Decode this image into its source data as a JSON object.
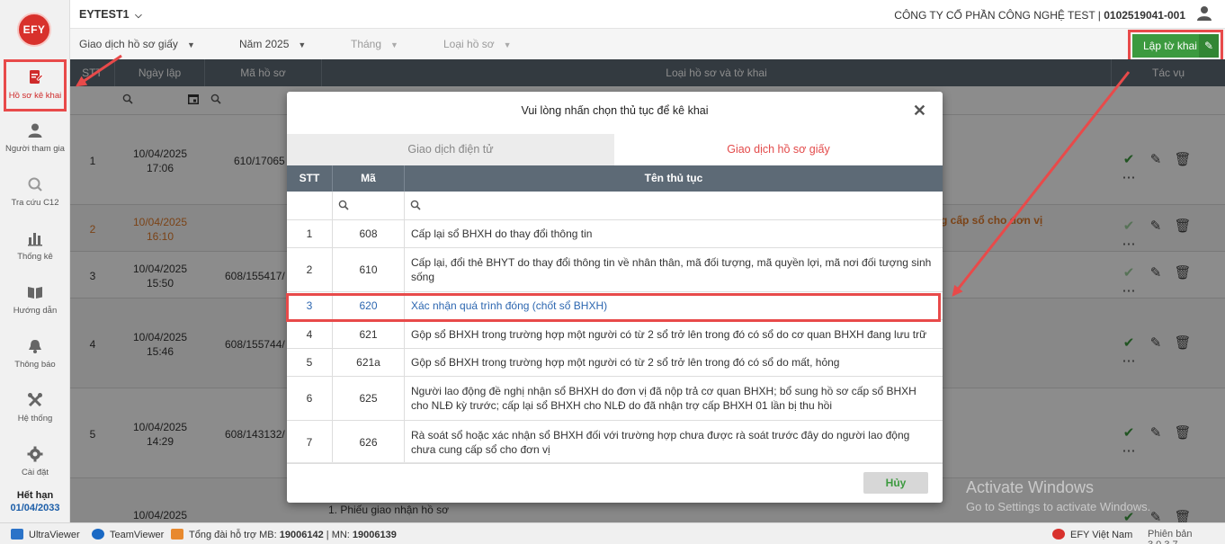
{
  "sidebar": {
    "logo": "EFY",
    "items": [
      {
        "label": "Hồ sơ kê khai",
        "icon": "document-edit-icon"
      },
      {
        "label": "Người tham gia",
        "icon": "user-icon"
      },
      {
        "label": "Tra cứu C12",
        "icon": "search-icon"
      },
      {
        "label": "Thống kê",
        "icon": "bar-chart-icon"
      },
      {
        "label": "Hướng dẫn",
        "icon": "book-icon"
      },
      {
        "label": "Thông báo",
        "icon": "bell-icon"
      },
      {
        "label": "Hệ thống",
        "icon": "tools-icon"
      },
      {
        "label": "Cài đặt",
        "icon": "gear-icon"
      }
    ],
    "expiry_label": "Hết hạn",
    "expiry_date": "01/04/2033"
  },
  "header": {
    "tenant": "EYTEST1",
    "company": "CÔNG TY CỔ PHẦN CÔNG NGHỆ TEST | ",
    "tax_code": "0102519041-001"
  },
  "filters": {
    "type": "Giao dịch hồ sơ giấy",
    "year": "Năm 2025",
    "month": "Tháng",
    "doc_type": "Loại hồ sơ",
    "create_button": "Lập tờ khai"
  },
  "main_table": {
    "headers": [
      "STT",
      "Ngày lập",
      "Mã hồ sơ",
      "Loại hồ sơ và tờ khai",
      "Tác vụ"
    ],
    "rows": [
      {
        "stt": "1",
        "date": "10/04/2025",
        "time": "17:06",
        "code": "610/17065",
        "desc": ""
      },
      {
        "stt": "2",
        "date": "10/04/2025",
        "time": "16:10",
        "code": "",
        "desc": "g cấp sổ cho đơn vị"
      },
      {
        "stt": "3",
        "date": "10/04/2025",
        "time": "15:50",
        "code": "608/155417/",
        "desc": ""
      },
      {
        "stt": "4",
        "date": "10/04/2025",
        "time": "15:46",
        "code": "608/155744/",
        "desc": ""
      },
      {
        "stt": "5",
        "date": "10/04/2025",
        "time": "14:29",
        "code": "608/143132/",
        "desc": ""
      },
      {
        "stt": "6",
        "date": "10/04/2025",
        "time": "",
        "code": "",
        "desc": "1. Phiếu giao nhận hồ sơ"
      }
    ]
  },
  "modal": {
    "title": "Vui lòng nhấn chọn thủ tục để kê khai",
    "tabs": [
      "Giao dịch điện tử",
      "Giao dịch hồ sơ giấy"
    ],
    "headers": [
      "STT",
      "Mã",
      "Tên thủ tục"
    ],
    "rows": [
      {
        "stt": "1",
        "code": "608",
        "name": "Cấp lại sổ BHXH do thay đổi thông tin"
      },
      {
        "stt": "2",
        "code": "610",
        "name": "Cấp lại, đổi thẻ BHYT do thay đổi thông tin về nhân thân, mã đối tượng, mã quyền lợi, mã nơi đối tượng sinh sống"
      },
      {
        "stt": "3",
        "code": "620",
        "name": "Xác nhận quá trình đóng (chốt sổ BHXH)"
      },
      {
        "stt": "4",
        "code": "621",
        "name": "Gộp sổ BHXH trong trường hợp một người có từ 2 sổ trở lên trong đó có sổ do cơ quan BHXH đang lưu trữ"
      },
      {
        "stt": "5",
        "code": "621a",
        "name": "Gộp sổ BHXH trong trường hợp một người có từ 2 sổ trở lên trong đó có sổ do mất, hỏng"
      },
      {
        "stt": "6",
        "code": "625",
        "name": "Người lao động đề nghị nhận sổ BHXH do đơn vị đã nộp trả cơ quan BHXH; bổ sung hồ sơ cấp sổ BHXH cho NLĐ kỳ trước; cấp lại sổ BHXH cho NLĐ do đã nhận trợ cấp BHXH 01 lần bị thu hồi"
      },
      {
        "stt": "7",
        "code": "626",
        "name": "Rà soát sổ hoặc xác nhận sổ BHXH đối với trường hợp chưa được rà soát trước đây do người lao động chưa cung cấp sổ cho đơn vị"
      }
    ],
    "cancel": "Hủy"
  },
  "watermark": {
    "line1": "Activate Windows",
    "line2": "Go to Settings to activate Windows."
  },
  "statusbar": {
    "ultraviewer": "UltraViewer",
    "teamviewer": "TeamViewer",
    "hotline_prefix": "Tổng đài hỗ trợ MB: ",
    "hotline_mb": "19006142",
    "hotline_sep": " | MN: ",
    "hotline_mn": "19006139",
    "brand": "EFY Việt Nam",
    "version": "Phiên bản 3.0.3.7"
  },
  "colors": {
    "accent_red": "#e34a4a",
    "green": "#3c9a3f",
    "header_gray": "#5d6a76",
    "selected_blue": "#2d67b0"
  }
}
